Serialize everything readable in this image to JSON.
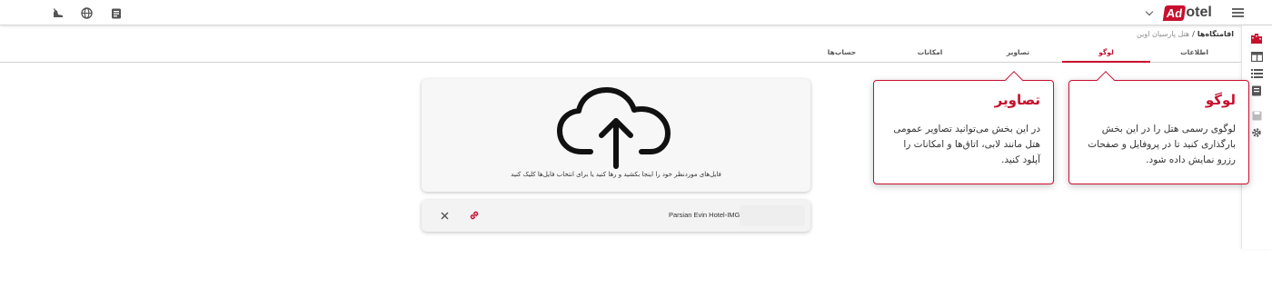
{
  "header": {
    "logo_badge": "Ad",
    "logo_text": "otel",
    "icons": [
      "menu-icon",
      "chevron-down-icon",
      "clipboard-icon",
      "globe-icon",
      "flag-user-icon"
    ]
  },
  "breadcrumb": {
    "root": "اقامتگاه‌ها",
    "separator": "/",
    "current": "هتل پارسیان اوین"
  },
  "tabs": [
    {
      "label": "اطلاعات",
      "active": false
    },
    {
      "label": "لوگو",
      "active": true
    },
    {
      "label": "تصاویر",
      "active": false
    },
    {
      "label": "امکانات",
      "active": false
    },
    {
      "label": "حساب‌ها",
      "active": false
    }
  ],
  "upload": {
    "dropzone_text": "فایل‌های موردنظر خود را اینجا بکشید و رها کنید یا برای انتخاب فایل‌ها کلیک کنید",
    "file_name": "Parsian Evin Hotel-IMG"
  },
  "tooltips": {
    "logo": {
      "title": "لوگو",
      "body": "لوگوی رسمی هتل را در این بخش بارگذاری کنید تا در پروفایل و صفحات رزرو نمایش داده شود."
    },
    "images": {
      "title": "تصاویر",
      "body": "در این بخش می‌توانید تصاویر عمومی هتل مانند لابی، اتاق‌ها و امکانات را آپلود کنید."
    }
  },
  "colors": {
    "accent": "#c8102e",
    "text": "#333333"
  }
}
